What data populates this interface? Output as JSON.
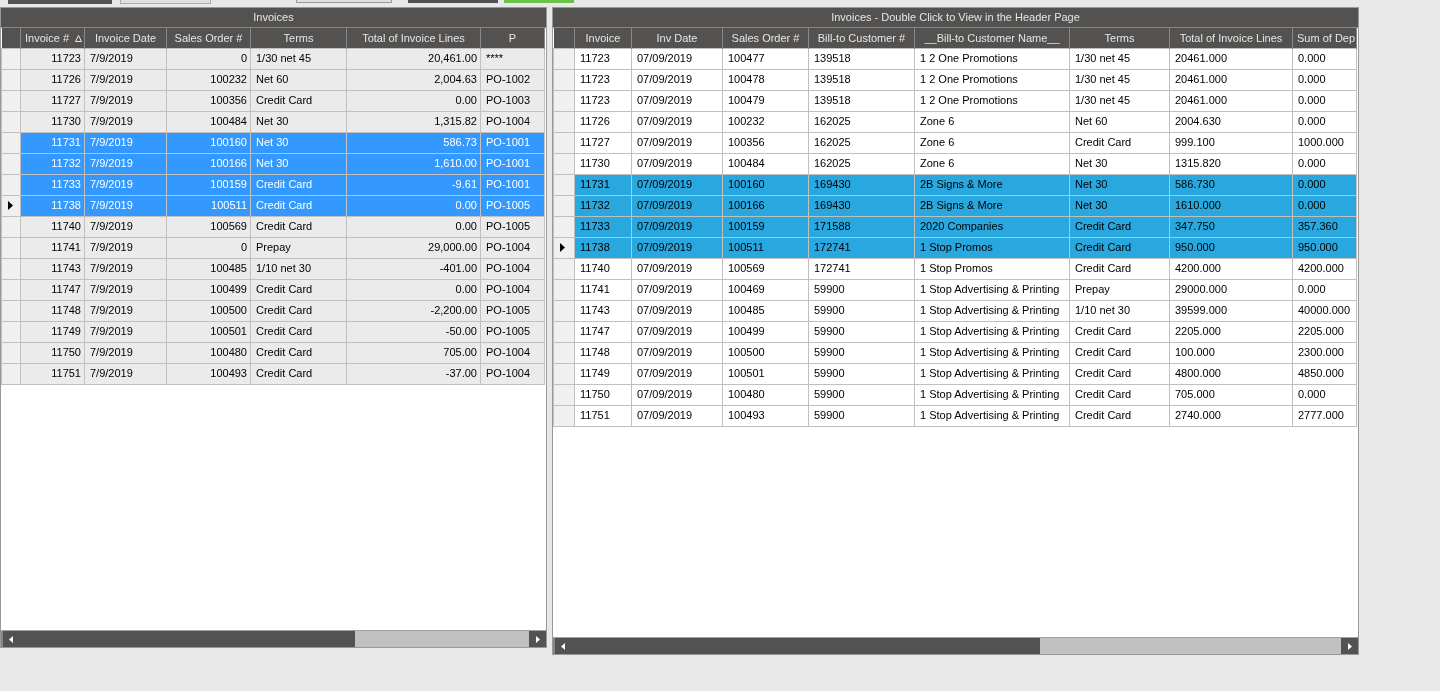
{
  "left_grid": {
    "title": "Invoices",
    "columns": [
      {
        "label": "Invoice #",
        "sorted": true,
        "kind": "number"
      },
      {
        "label": "Invoice Date",
        "sorted": false,
        "kind": "text"
      },
      {
        "label": "Sales Order #",
        "sorted": false,
        "kind": "number"
      },
      {
        "label": "Terms",
        "sorted": false,
        "kind": "text"
      },
      {
        "label": "Total of Invoice Lines",
        "sorted": false,
        "kind": "number"
      },
      {
        "label": "P",
        "sorted": false,
        "kind": "text"
      }
    ],
    "rows": [
      {
        "selected": false,
        "current": false,
        "cells": [
          "11723",
          "7/9/2019",
          "0",
          "1/30 net 45",
          "20,461.00",
          "****"
        ]
      },
      {
        "selected": false,
        "current": false,
        "cells": [
          "11726",
          "7/9/2019",
          "100232",
          "Net 60",
          "2,004.63",
          "PO-1002"
        ]
      },
      {
        "selected": false,
        "current": false,
        "cells": [
          "11727",
          "7/9/2019",
          "100356",
          "Credit Card",
          "0.00",
          "PO-1003"
        ]
      },
      {
        "selected": false,
        "current": false,
        "cells": [
          "11730",
          "7/9/2019",
          "100484",
          "Net 30",
          "1,315.82",
          "PO-1004"
        ]
      },
      {
        "selected": true,
        "current": false,
        "cells": [
          "11731",
          "7/9/2019",
          "100160",
          "Net 30",
          "586.73",
          "PO-1001"
        ]
      },
      {
        "selected": true,
        "current": false,
        "cells": [
          "11732",
          "7/9/2019",
          "100166",
          "Net 30",
          "1,610.00",
          "PO-1001"
        ]
      },
      {
        "selected": true,
        "current": false,
        "cells": [
          "11733",
          "7/9/2019",
          "100159",
          "Credit Card",
          "-9.61",
          "PO-1001"
        ]
      },
      {
        "selected": true,
        "current": true,
        "cells": [
          "11738",
          "7/9/2019",
          "100511",
          "Credit Card",
          "0.00",
          "PO-1005"
        ]
      },
      {
        "selected": false,
        "current": false,
        "cells": [
          "11740",
          "7/9/2019",
          "100569",
          "Credit Card",
          "0.00",
          "PO-1005"
        ]
      },
      {
        "selected": false,
        "current": false,
        "cells": [
          "11741",
          "7/9/2019",
          "0",
          "Prepay",
          "29,000.00",
          "PO-1004"
        ]
      },
      {
        "selected": false,
        "current": false,
        "cells": [
          "11743",
          "7/9/2019",
          "100485",
          "1/10 net 30",
          "-401.00",
          "PO-1004"
        ]
      },
      {
        "selected": false,
        "current": false,
        "cells": [
          "11747",
          "7/9/2019",
          "100499",
          "Credit Card",
          "0.00",
          "PO-1004"
        ]
      },
      {
        "selected": false,
        "current": false,
        "cells": [
          "11748",
          "7/9/2019",
          "100500",
          "Credit Card",
          "-2,200.00",
          "PO-1005"
        ]
      },
      {
        "selected": false,
        "current": false,
        "cells": [
          "11749",
          "7/9/2019",
          "100501",
          "Credit Card",
          "-50.00",
          "PO-1005"
        ]
      },
      {
        "selected": false,
        "current": false,
        "cells": [
          "11750",
          "7/9/2019",
          "100480",
          "Credit Card",
          "705.00",
          "PO-1004"
        ]
      },
      {
        "selected": false,
        "current": false,
        "cells": [
          "11751",
          "7/9/2019",
          "100493",
          "Credit Card",
          "-37.00",
          "PO-1004"
        ]
      }
    ]
  },
  "right_grid": {
    "title": "Invoices - Double Click to View in the Header Page",
    "columns": [
      {
        "label": "Invoice"
      },
      {
        "label": "Inv Date"
      },
      {
        "label": "Sales Order #"
      },
      {
        "label": "Bill-to Customer #"
      },
      {
        "label": "__Bill-to Customer Name__"
      },
      {
        "label": "Terms"
      },
      {
        "label": "Total of Invoice Lines"
      },
      {
        "label": "Sum of Dep"
      }
    ],
    "rows": [
      {
        "selected": false,
        "current": false,
        "cells": [
          "11723",
          "07/09/2019",
          "100477",
          "139518",
          "1 2 One Promotions",
          "1/30 net 45",
          "20461.000",
          "0.000"
        ]
      },
      {
        "selected": false,
        "current": false,
        "cells": [
          "11723",
          "07/09/2019",
          "100478",
          "139518",
          "1 2 One Promotions",
          "1/30 net 45",
          "20461.000",
          "0.000"
        ]
      },
      {
        "selected": false,
        "current": false,
        "cells": [
          "11723",
          "07/09/2019",
          "100479",
          "139518",
          "1 2 One Promotions",
          "1/30 net 45",
          "20461.000",
          "0.000"
        ]
      },
      {
        "selected": false,
        "current": false,
        "cells": [
          "11726",
          "07/09/2019",
          "100232",
          "162025",
          "Zone 6",
          "Net 60",
          "2004.630",
          "0.000"
        ]
      },
      {
        "selected": false,
        "current": false,
        "cells": [
          "11727",
          "07/09/2019",
          "100356",
          "162025",
          "Zone 6",
          "Credit Card",
          "999.100",
          "1000.000"
        ]
      },
      {
        "selected": false,
        "current": false,
        "cells": [
          "11730",
          "07/09/2019",
          "100484",
          "162025",
          "Zone 6",
          "Net 30",
          "1315.820",
          "0.000"
        ]
      },
      {
        "selected": true,
        "current": false,
        "cells": [
          "11731",
          "07/09/2019",
          "100160",
          "169430",
          "2B Signs & More",
          "Net 30",
          "586.730",
          "0.000"
        ]
      },
      {
        "selected": true,
        "current": false,
        "cells": [
          "11732",
          "07/09/2019",
          "100166",
          "169430",
          "2B Signs & More",
          "Net 30",
          "1610.000",
          "0.000"
        ]
      },
      {
        "selected": true,
        "current": false,
        "cells": [
          "11733",
          "07/09/2019",
          "100159",
          "171588",
          "2020 Companies",
          "Credit Card",
          "347.750",
          "357.360"
        ]
      },
      {
        "selected": true,
        "current": true,
        "cells": [
          "11738",
          "07/09/2019",
          "100511",
          "172741",
          "1 Stop Promos",
          "Credit Card",
          "950.000",
          "950.000"
        ]
      },
      {
        "selected": false,
        "current": false,
        "cells": [
          "11740",
          "07/09/2019",
          "100569",
          "172741",
          "1 Stop Promos",
          "Credit Card",
          "4200.000",
          "4200.000"
        ]
      },
      {
        "selected": false,
        "current": false,
        "cells": [
          "11741",
          "07/09/2019",
          "100469",
          "59900",
          "1 Stop Advertising & Printing",
          "Prepay",
          "29000.000",
          "0.000"
        ]
      },
      {
        "selected": false,
        "current": false,
        "cells": [
          "11743",
          "07/09/2019",
          "100485",
          "59900",
          "1 Stop Advertising & Printing",
          "1/10 net 30",
          "39599.000",
          "40000.000"
        ]
      },
      {
        "selected": false,
        "current": false,
        "cells": [
          "11747",
          "07/09/2019",
          "100499",
          "59900",
          "1 Stop Advertising & Printing",
          "Credit Card",
          "2205.000",
          "2205.000"
        ]
      },
      {
        "selected": false,
        "current": false,
        "cells": [
          "11748",
          "07/09/2019",
          "100500",
          "59900",
          "1 Stop Advertising & Printing",
          "Credit Card",
          "100.000",
          "2300.000"
        ]
      },
      {
        "selected": false,
        "current": false,
        "cells": [
          "11749",
          "07/09/2019",
          "100501",
          "59900",
          "1 Stop Advertising & Printing",
          "Credit Card",
          "4800.000",
          "4850.000"
        ]
      },
      {
        "selected": false,
        "current": false,
        "cells": [
          "11750",
          "07/09/2019",
          "100480",
          "59900",
          "1 Stop Advertising & Printing",
          "Credit Card",
          "705.000",
          "0.000"
        ]
      },
      {
        "selected": false,
        "current": false,
        "cells": [
          "11751",
          "07/09/2019",
          "100493",
          "59900",
          "1 Stop Advertising & Printing",
          "Credit Card",
          "2740.000",
          "2777.000"
        ]
      }
    ]
  }
}
